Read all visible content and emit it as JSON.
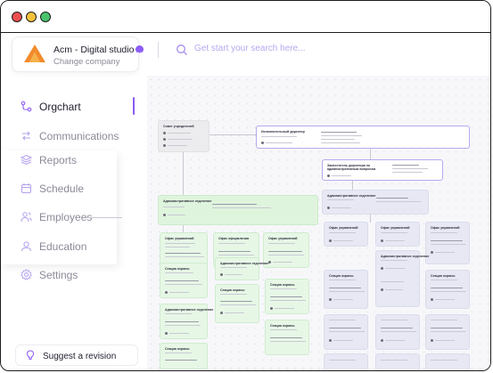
{
  "window": {
    "controls": [
      "close",
      "minimize",
      "maximize"
    ]
  },
  "company": {
    "name": "Acm - Digital studio",
    "subtitle": "Change company",
    "logo_colors": [
      "#f28b2c",
      "#f5b04a"
    ],
    "caret_color": "#8b5cf6"
  },
  "search": {
    "placeholder": "Get start your search here..."
  },
  "sidebar": {
    "items": [
      {
        "label": "Orgchart",
        "icon": "orgchart-icon",
        "active": true
      },
      {
        "label": "Communications",
        "icon": "communications-icon",
        "active": false
      },
      {
        "label": "Reports",
        "icon": "reports-icon",
        "active": false
      },
      {
        "label": "Schedule",
        "icon": "calendar-icon",
        "active": false
      },
      {
        "label": "Employees",
        "icon": "employees-icon",
        "active": false
      },
      {
        "label": "Education",
        "icon": "education-icon",
        "active": false
      },
      {
        "label": "Settings",
        "icon": "gear-icon",
        "active": false
      }
    ],
    "suggest_label": "Suggest a revision"
  },
  "orgchart": {
    "top_nodes": {
      "council": "Совет учредителей",
      "director": "Исполнительный директор",
      "deputy": "Заместитель директора по административным вопросам",
      "admin_green": "Административное отделение",
      "admin_lav": "Административное отделение"
    },
    "column_heads": [
      "Офис управлений",
      "Офис оформления",
      "Офис управлений",
      "Офис управлений",
      "Офис управлений",
      "Офис управлений"
    ],
    "sub_nodes": [
      "Секция охраны",
      "Административное отделение",
      "Секция охраны",
      "Секция охраны",
      "Административное отделение",
      "Секция охраны",
      "Секция охраны",
      "Административное отделение",
      "Секция охраны"
    ]
  },
  "colors": {
    "accent": "#8b5cf6",
    "node_green": "#e7f7e6",
    "node_lavender": "#e7e8f3"
  }
}
